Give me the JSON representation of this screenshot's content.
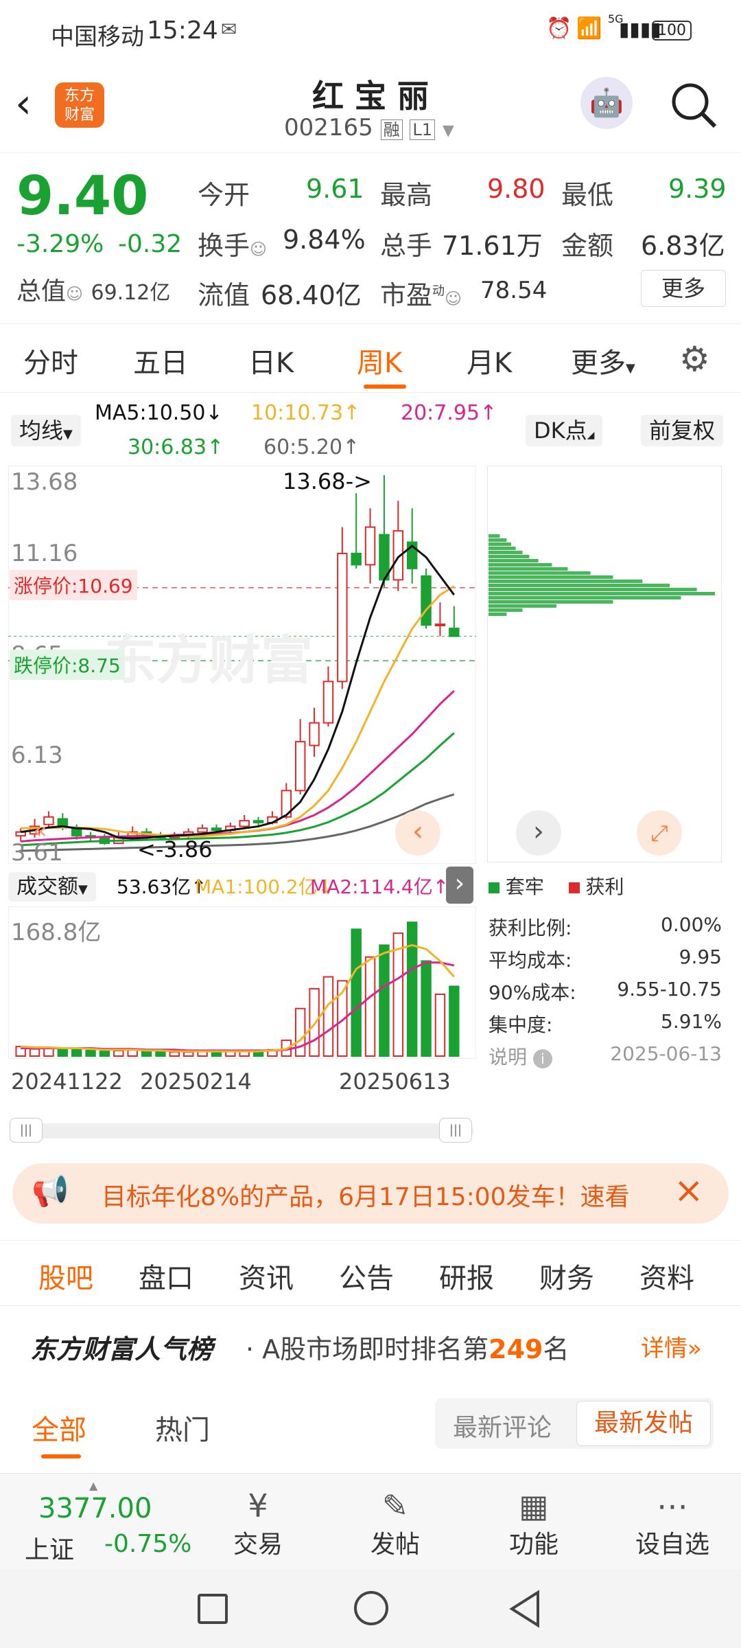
{
  "status": {
    "carrier": "中国移动",
    "time": "15:24",
    "battery": "100",
    "net": "5G"
  },
  "header": {
    "logo_line1": "东方",
    "logo_line2": "财富",
    "title": "红 宝 丽",
    "code": "002165",
    "tag1": "融",
    "tag2": "L1"
  },
  "quote": {
    "price": "9.40",
    "change_pct": "-3.29%",
    "change": "-0.32",
    "open_label": "今开",
    "open": "9.61",
    "high_label": "最高",
    "high": "9.80",
    "low_label": "最低",
    "low": "9.39",
    "turnover_label": "换手",
    "turnover": "9.84%",
    "volume_label": "总手",
    "volume": "71.61万",
    "amount_label": "金额",
    "amount": "6.83亿",
    "mktcap_label": "总值",
    "mktcap": "69.12亿",
    "float_label": "流值",
    "float": "68.40亿",
    "pe_label": "市盈",
    "pe_sup": "动",
    "pe": "78.54",
    "more": "更多"
  },
  "tabs": [
    "分时",
    "五日",
    "日K",
    "周K",
    "月K",
    "更多"
  ],
  "ma_bar": {
    "selector": "均线",
    "ma5": "MA5:10.50↓",
    "ma10": "10:10.73↑",
    "ma20": "20:7.95↑",
    "ma30": "30:6.83↑",
    "ma60": "60:5.20↑",
    "dk": "DK点",
    "adjust": "前复权"
  },
  "colors": {
    "up": "#e02a2a",
    "down": "#19a232",
    "accent": "#ff6600",
    "ma5": "#111111",
    "ma10": "#f0b429",
    "ma20": "#d9268f",
    "ma30": "#19a232",
    "ma60": "#666666"
  },
  "kline": {
    "y_labels": [
      "13.68",
      "11.16",
      "8.65",
      "6.13",
      "3.61"
    ],
    "max_label": "13.68->",
    "min_label": "<-3.86",
    "limit_up": "涨停价:10.69",
    "limit_down": "跌停价:8.75",
    "watermark": "东方财富"
  },
  "chart_data": {
    "type": "candlestick",
    "y_range": [
      3.61,
      13.68
    ],
    "candles": [
      {
        "o": 4.1,
        "c": 4.2,
        "h": 4.3,
        "l": 3.95
      },
      {
        "o": 4.15,
        "c": 4.35,
        "h": 4.55,
        "l": 4.05
      },
      {
        "o": 4.4,
        "c": 4.6,
        "h": 4.75,
        "l": 4.3
      },
      {
        "o": 4.55,
        "c": 4.35,
        "h": 4.7,
        "l": 4.25
      },
      {
        "o": 4.3,
        "c": 4.1,
        "h": 4.4,
        "l": 4.0
      },
      {
        "o": 4.1,
        "c": 4.05,
        "h": 4.2,
        "l": 3.95
      },
      {
        "o": 4.05,
        "c": 3.9,
        "h": 4.15,
        "l": 3.86
      },
      {
        "o": 3.9,
        "c": 4.05,
        "h": 4.2,
        "l": 3.88
      },
      {
        "o": 4.05,
        "c": 4.2,
        "h": 4.35,
        "l": 3.98
      },
      {
        "o": 4.2,
        "c": 4.1,
        "h": 4.3,
        "l": 4.0
      },
      {
        "o": 4.1,
        "c": 4.05,
        "h": 4.2,
        "l": 3.98
      },
      {
        "o": 4.05,
        "c": 4.1,
        "h": 4.2,
        "l": 4.0
      },
      {
        "o": 4.1,
        "c": 4.2,
        "h": 4.3,
        "l": 4.02
      },
      {
        "o": 4.2,
        "c": 4.3,
        "h": 4.4,
        "l": 4.1
      },
      {
        "o": 4.3,
        "c": 4.25,
        "h": 4.4,
        "l": 4.15
      },
      {
        "o": 4.25,
        "c": 4.35,
        "h": 4.45,
        "l": 4.18
      },
      {
        "o": 4.35,
        "c": 4.5,
        "h": 4.65,
        "l": 4.3
      },
      {
        "o": 4.5,
        "c": 4.45,
        "h": 4.6,
        "l": 4.38
      },
      {
        "o": 4.45,
        "c": 4.6,
        "h": 4.75,
        "l": 4.4
      },
      {
        "o": 4.6,
        "c": 5.3,
        "h": 5.5,
        "l": 4.55
      },
      {
        "o": 5.3,
        "c": 6.6,
        "h": 7.2,
        "l": 5.2
      },
      {
        "o": 6.5,
        "c": 7.1,
        "h": 7.5,
        "l": 6.2
      },
      {
        "o": 7.1,
        "c": 8.2,
        "h": 8.6,
        "l": 7.0
      },
      {
        "o": 8.2,
        "c": 11.6,
        "h": 12.3,
        "l": 8.0
      },
      {
        "o": 11.6,
        "c": 11.3,
        "h": 13.2,
        "l": 11.2
      },
      {
        "o": 11.3,
        "c": 12.3,
        "h": 12.8,
        "l": 10.8
      },
      {
        "o": 12.1,
        "c": 10.9,
        "h": 13.68,
        "l": 10.7
      },
      {
        "o": 10.9,
        "c": 12.2,
        "h": 13.0,
        "l": 10.6
      },
      {
        "o": 11.9,
        "c": 11.2,
        "h": 12.8,
        "l": 10.8
      },
      {
        "o": 11.0,
        "c": 9.7,
        "h": 11.2,
        "l": 9.6
      },
      {
        "o": 9.72,
        "c": 9.72,
        "h": 10.3,
        "l": 9.4
      },
      {
        "o": 9.61,
        "c": 9.4,
        "h": 10.2,
        "l": 9.39
      }
    ],
    "ma5": [
      4.2,
      4.25,
      4.32,
      4.35,
      4.3,
      4.28,
      4.2,
      4.05,
      4.03,
      4.05,
      4.08,
      4.1,
      4.12,
      4.15,
      4.2,
      4.25,
      4.3,
      4.35,
      4.45,
      4.65,
      5.0,
      5.6,
      6.4,
      7.4,
      8.7,
      9.9,
      10.9,
      11.5,
      11.8,
      11.5,
      11.0,
      10.5
    ],
    "ma10": [
      4.3,
      4.3,
      4.31,
      4.32,
      4.32,
      4.3,
      4.28,
      4.22,
      4.17,
      4.15,
      4.12,
      4.1,
      4.09,
      4.09,
      4.12,
      4.15,
      4.2,
      4.25,
      4.3,
      4.4,
      4.6,
      4.9,
      5.3,
      5.9,
      6.6,
      7.4,
      8.2,
      8.9,
      9.6,
      10.1,
      10.5,
      10.73
    ],
    "ma20": [
      3.95,
      3.98,
      4.0,
      4.02,
      4.04,
      4.06,
      4.07,
      4.08,
      4.09,
      4.1,
      4.11,
      4.12,
      4.13,
      4.14,
      4.15,
      4.17,
      4.2,
      4.24,
      4.29,
      4.38,
      4.5,
      4.65,
      4.85,
      5.1,
      5.4,
      5.75,
      6.1,
      6.45,
      6.8,
      7.2,
      7.6,
      7.95
    ],
    "ma30": [
      3.85,
      3.87,
      3.89,
      3.91,
      3.93,
      3.95,
      3.96,
      3.97,
      3.98,
      3.99,
      4.0,
      4.01,
      4.02,
      4.03,
      4.04,
      4.05,
      4.07,
      4.1,
      4.13,
      4.18,
      4.25,
      4.34,
      4.46,
      4.62,
      4.8,
      5.0,
      5.25,
      5.55,
      5.85,
      6.15,
      6.5,
      6.83
    ],
    "ma60": [
      3.7,
      3.71,
      3.72,
      3.73,
      3.74,
      3.75,
      3.76,
      3.77,
      3.78,
      3.79,
      3.8,
      3.81,
      3.82,
      3.83,
      3.84,
      3.85,
      3.86,
      3.88,
      3.9,
      3.93,
      3.97,
      4.02,
      4.08,
      4.15,
      4.24,
      4.35,
      4.48,
      4.62,
      4.78,
      4.95,
      5.08,
      5.2
    ],
    "volume": [
      12,
      9,
      10,
      8,
      9,
      7,
      6,
      7,
      8,
      6,
      6,
      5,
      5,
      6,
      5,
      6,
      7,
      6,
      8,
      20,
      60,
      85,
      100,
      95,
      160,
      125,
      140,
      155,
      168.8,
      120,
      78,
      88
    ],
    "vol_ma1": [
      12,
      11,
      11,
      10,
      10,
      9,
      8,
      8,
      8,
      7,
      7,
      6,
      6,
      6,
      6,
      6,
      6,
      6,
      7,
      9,
      20,
      40,
      65,
      80,
      110,
      122,
      130,
      135,
      140,
      135,
      120,
      100.2
    ],
    "vol_ma2": [
      10,
      10,
      10,
      10,
      10,
      10,
      9,
      9,
      9,
      8,
      8,
      8,
      7,
      7,
      7,
      7,
      7,
      7,
      7,
      8,
      12,
      20,
      32,
      45,
      60,
      75,
      88,
      98,
      110,
      118,
      118,
      114.4
    ]
  },
  "volume_panel": {
    "selector": "成交额",
    "vol": "53.63亿↑",
    "ma1": "MA1:100.2亿↓",
    "ma2": "MA2:114.4亿↑",
    "max_label": "168.8亿"
  },
  "dates": [
    "20241122",
    "20250214",
    "20250613"
  ],
  "chip": {
    "legend_trap": "套牢",
    "legend_profit": "获利",
    "rows": [
      {
        "k": "获利比例:",
        "v": "0.00%"
      },
      {
        "k": "平均成本:",
        "v": "9.95"
      },
      {
        "k": "90%成本:",
        "v": "9.55-10.75"
      },
      {
        "k": "集中度:",
        "v": "5.91%"
      }
    ],
    "note": "说明",
    "date": "2025-06-13",
    "bars": [
      0.05,
      0.08,
      0.1,
      0.12,
      0.15,
      0.18,
      0.22,
      0.28,
      0.35,
      0.45,
      0.55,
      0.68,
      0.8,
      0.92,
      1.0,
      0.85,
      0.55,
      0.3,
      0.15,
      0.08
    ]
  },
  "banner": {
    "text": "目标年化8%的产品，6月17日15:00发车！速看"
  },
  "subtabs": [
    "股吧",
    "盘口",
    "资讯",
    "公告",
    "研报",
    "财务",
    "资料"
  ],
  "rank": {
    "title": "东方财富人气榜",
    "text_pre": "A股市场即时排名第",
    "rank": "249",
    "text_post": "名",
    "detail": "详情"
  },
  "filter": {
    "all": "全部",
    "hot": "热门",
    "latest_comment": "最新评论",
    "latest_post": "最新发帖"
  },
  "bottom": {
    "index_value": "3377.00",
    "index_name": "上证",
    "index_change": "-0.75%",
    "trade": "交易",
    "post": "发帖",
    "func": "功能",
    "watch": "设自选"
  }
}
